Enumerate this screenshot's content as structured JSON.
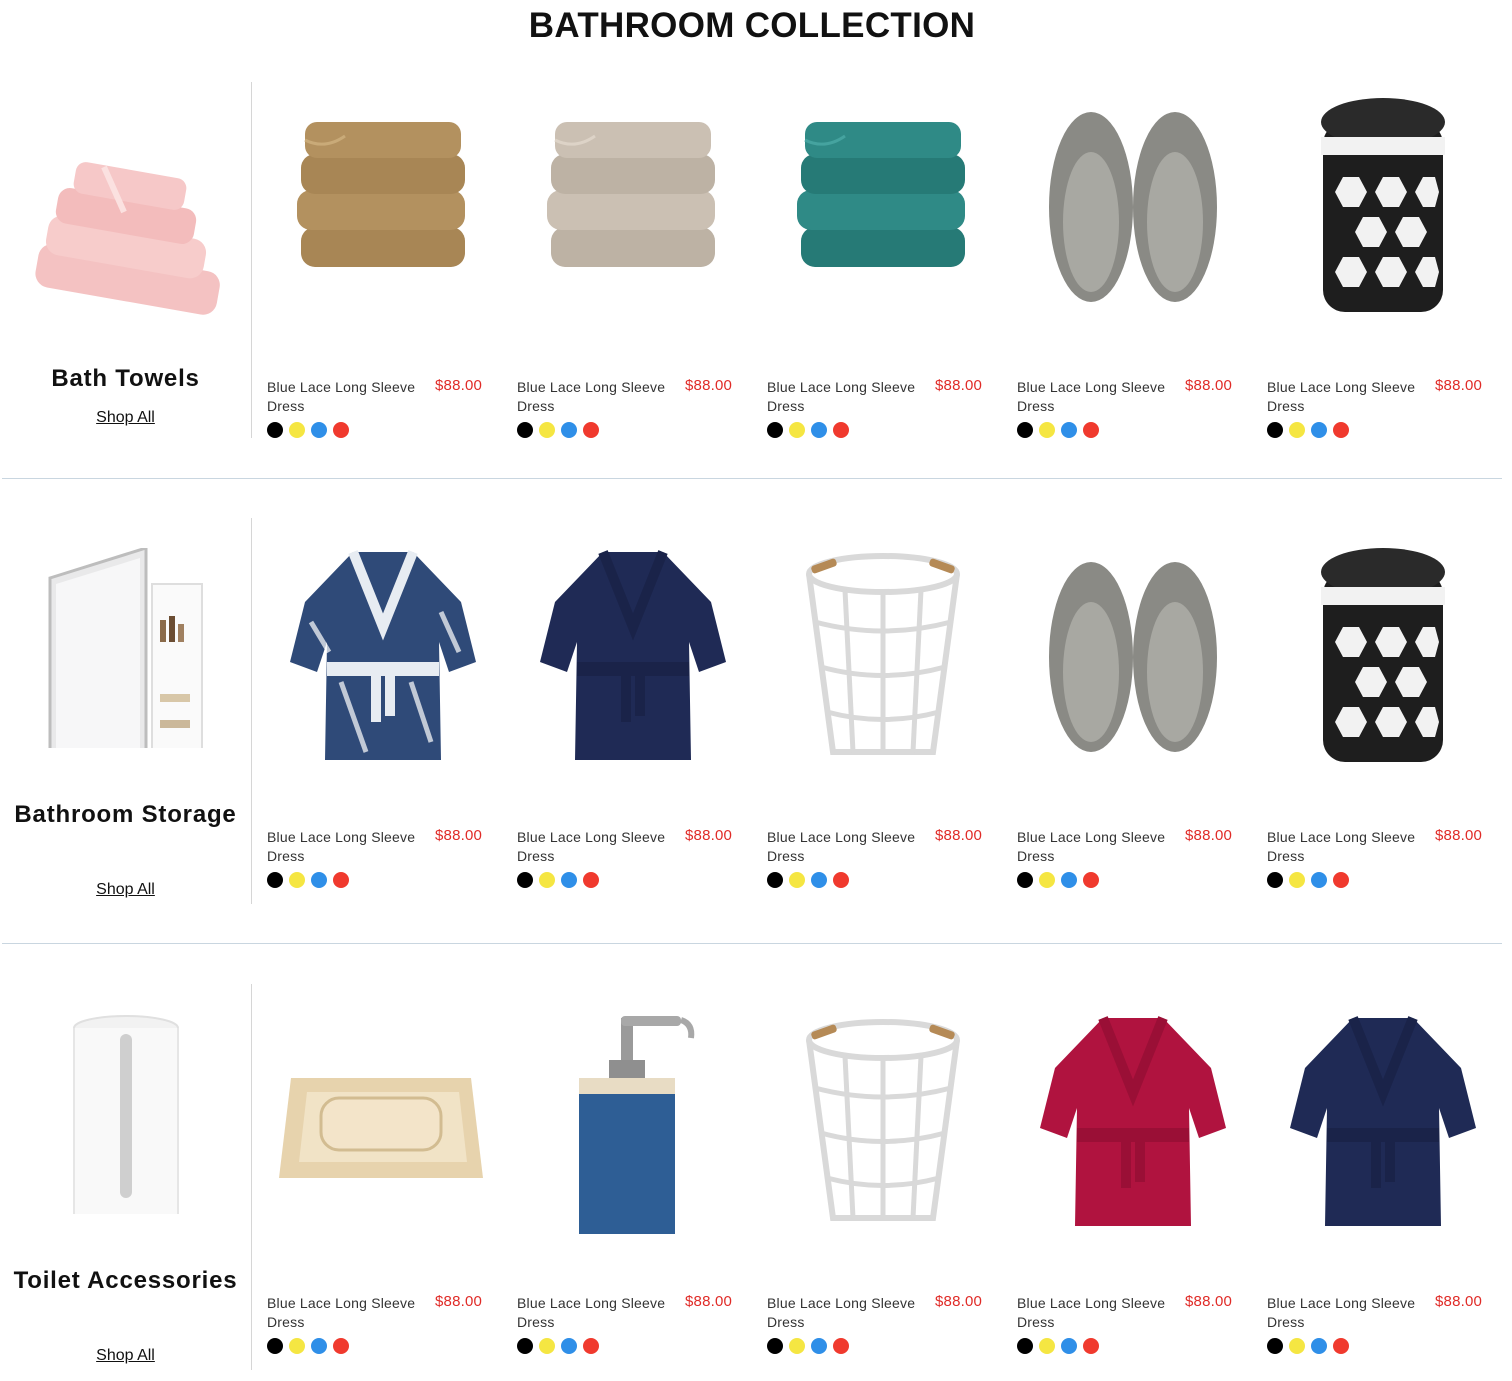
{
  "page": {
    "title": "BATHROOM COLLECTION"
  },
  "colors": {
    "price": "#e02b27",
    "divider": "#c9d6e0",
    "swatches": [
      "#000000",
      "#f5e642",
      "#2f8fe8",
      "#f03a2e"
    ]
  },
  "sections": [
    {
      "category": {
        "title": "Bath Towels",
        "shop_all": "Shop All",
        "image": "pink-towel-stack"
      },
      "products": [
        {
          "name": "Blue Lace Long Sleeve Dress",
          "price": "$88.00",
          "image": "tan-towel-stack"
        },
        {
          "name": "Blue Lace Long Sleeve Dress",
          "price": "$88.00",
          "image": "beige-textured-towels"
        },
        {
          "name": "Blue Lace Long Sleeve Dress",
          "price": "$88.00",
          "image": "teal-towels"
        },
        {
          "name": "Blue Lace Long Sleeve Dress",
          "price": "$88.00",
          "image": "grey-slippers"
        },
        {
          "name": "Blue Lace Long Sleeve Dress",
          "price": "$88.00",
          "image": "black-lattice-bin"
        }
      ]
    },
    {
      "category": {
        "title": "Bathroom Storage",
        "shop_all": "Shop All",
        "image": "mirror-cabinet"
      },
      "products": [
        {
          "name": "Blue Lace Long Sleeve Dress",
          "price": "$88.00",
          "image": "patterned-bathrobe"
        },
        {
          "name": "Blue Lace Long Sleeve Dress",
          "price": "$88.00",
          "image": "navy-bathrobe"
        },
        {
          "name": "Blue Lace Long Sleeve Dress",
          "price": "$88.00",
          "image": "wire-basket"
        },
        {
          "name": "Blue Lace Long Sleeve Dress",
          "price": "$88.00",
          "image": "grey-slippers"
        },
        {
          "name": "Blue Lace Long Sleeve Dress",
          "price": "$88.00",
          "image": "black-lattice-bin"
        }
      ]
    },
    {
      "category": {
        "title": "Toilet Accessories",
        "shop_all": "Shop All",
        "image": "white-tissue-holder"
      },
      "products": [
        {
          "name": "Blue Lace Long Sleeve Dress",
          "price": "$88.00",
          "image": "soap-dish"
        },
        {
          "name": "Blue Lace Long Sleeve Dress",
          "price": "$88.00",
          "image": "soap-dispenser"
        },
        {
          "name": "Blue Lace Long Sleeve Dress",
          "price": "$88.00",
          "image": "wire-basket"
        },
        {
          "name": "Blue Lace Long Sleeve Dress",
          "price": "$88.00",
          "image": "red-bathrobe"
        },
        {
          "name": "Blue Lace Long Sleeve Dress",
          "price": "$88.00",
          "image": "navy-bathrobe"
        }
      ]
    }
  ]
}
